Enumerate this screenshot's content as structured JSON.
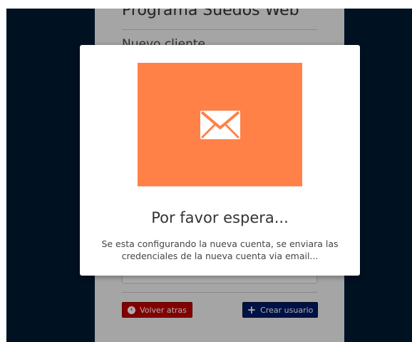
{
  "form": {
    "title": "Programa Suedos Web",
    "subtitle": "Nuevo cliente",
    "back_label": "Volver atras",
    "create_label": "Crear usuario"
  },
  "modal": {
    "icon": "envelope-icon",
    "title": "Por favor espera...",
    "message": "Se esta configurando la nueva cuenta, se enviara las credenciales de la nueva cuenta via email..."
  },
  "colors": {
    "background": "#001a33",
    "image_accent": "#ff8148",
    "back_button": "#c00000",
    "create_button": "#001a66"
  }
}
